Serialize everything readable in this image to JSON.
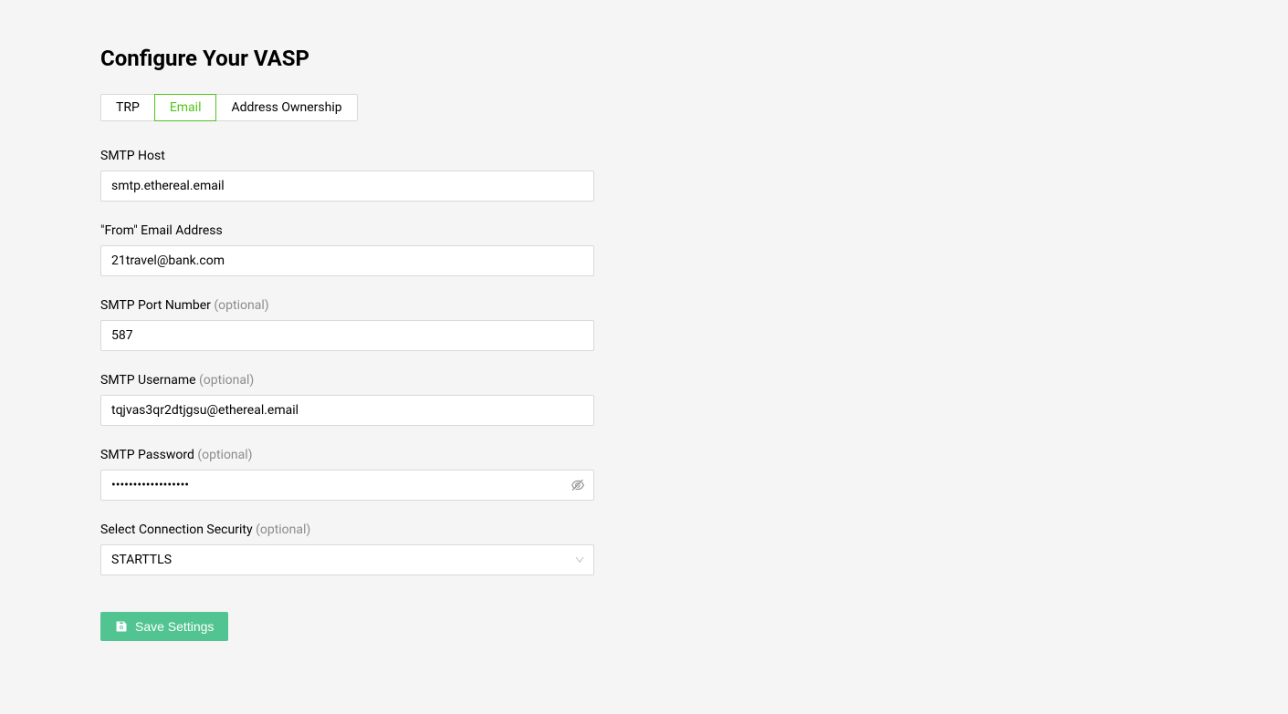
{
  "header": {
    "title": "Configure Your VASP"
  },
  "tabs": {
    "items": [
      {
        "label": "TRP",
        "active": false
      },
      {
        "label": "Email",
        "active": true
      },
      {
        "label": "Address Ownership",
        "active": false
      }
    ]
  },
  "form": {
    "smtp_host": {
      "label": "SMTP Host",
      "value": "smtp.ethereal.email"
    },
    "from_email": {
      "label": "\"From\" Email Address",
      "value": "21travel@bank.com"
    },
    "smtp_port": {
      "label": "SMTP Port Number",
      "optional_text": "(optional)",
      "value": "587"
    },
    "smtp_username": {
      "label": "SMTP Username",
      "optional_text": "(optional)",
      "value": "tqjvas3qr2dtjgsu@ethereal.email"
    },
    "smtp_password": {
      "label": "SMTP Password",
      "optional_text": "(optional)",
      "value": "••••••••••••••••••"
    },
    "connection_security": {
      "label": "Select Connection Security",
      "optional_text": "(optional)",
      "value": "STARTTLS"
    }
  },
  "actions": {
    "save_label": "Save Settings"
  }
}
